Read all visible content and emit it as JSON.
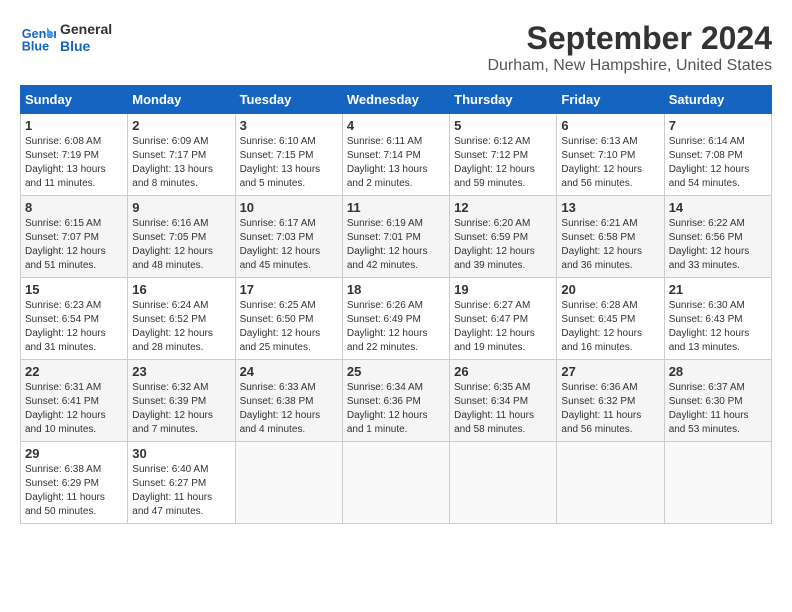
{
  "header": {
    "logo_line1": "General",
    "logo_line2": "Blue",
    "month": "September 2024",
    "location": "Durham, New Hampshire, United States"
  },
  "weekdays": [
    "Sunday",
    "Monday",
    "Tuesday",
    "Wednesday",
    "Thursday",
    "Friday",
    "Saturday"
  ],
  "weeks": [
    [
      {
        "day": "1",
        "info": "Sunrise: 6:08 AM\nSunset: 7:19 PM\nDaylight: 13 hours and 11 minutes."
      },
      {
        "day": "2",
        "info": "Sunrise: 6:09 AM\nSunset: 7:17 PM\nDaylight: 13 hours and 8 minutes."
      },
      {
        "day": "3",
        "info": "Sunrise: 6:10 AM\nSunset: 7:15 PM\nDaylight: 13 hours and 5 minutes."
      },
      {
        "day": "4",
        "info": "Sunrise: 6:11 AM\nSunset: 7:14 PM\nDaylight: 13 hours and 2 minutes."
      },
      {
        "day": "5",
        "info": "Sunrise: 6:12 AM\nSunset: 7:12 PM\nDaylight: 12 hours and 59 minutes."
      },
      {
        "day": "6",
        "info": "Sunrise: 6:13 AM\nSunset: 7:10 PM\nDaylight: 12 hours and 56 minutes."
      },
      {
        "day": "7",
        "info": "Sunrise: 6:14 AM\nSunset: 7:08 PM\nDaylight: 12 hours and 54 minutes."
      }
    ],
    [
      {
        "day": "8",
        "info": "Sunrise: 6:15 AM\nSunset: 7:07 PM\nDaylight: 12 hours and 51 minutes."
      },
      {
        "day": "9",
        "info": "Sunrise: 6:16 AM\nSunset: 7:05 PM\nDaylight: 12 hours and 48 minutes."
      },
      {
        "day": "10",
        "info": "Sunrise: 6:17 AM\nSunset: 7:03 PM\nDaylight: 12 hours and 45 minutes."
      },
      {
        "day": "11",
        "info": "Sunrise: 6:19 AM\nSunset: 7:01 PM\nDaylight: 12 hours and 42 minutes."
      },
      {
        "day": "12",
        "info": "Sunrise: 6:20 AM\nSunset: 6:59 PM\nDaylight: 12 hours and 39 minutes."
      },
      {
        "day": "13",
        "info": "Sunrise: 6:21 AM\nSunset: 6:58 PM\nDaylight: 12 hours and 36 minutes."
      },
      {
        "day": "14",
        "info": "Sunrise: 6:22 AM\nSunset: 6:56 PM\nDaylight: 12 hours and 33 minutes."
      }
    ],
    [
      {
        "day": "15",
        "info": "Sunrise: 6:23 AM\nSunset: 6:54 PM\nDaylight: 12 hours and 31 minutes."
      },
      {
        "day": "16",
        "info": "Sunrise: 6:24 AM\nSunset: 6:52 PM\nDaylight: 12 hours and 28 minutes."
      },
      {
        "day": "17",
        "info": "Sunrise: 6:25 AM\nSunset: 6:50 PM\nDaylight: 12 hours and 25 minutes."
      },
      {
        "day": "18",
        "info": "Sunrise: 6:26 AM\nSunset: 6:49 PM\nDaylight: 12 hours and 22 minutes."
      },
      {
        "day": "19",
        "info": "Sunrise: 6:27 AM\nSunset: 6:47 PM\nDaylight: 12 hours and 19 minutes."
      },
      {
        "day": "20",
        "info": "Sunrise: 6:28 AM\nSunset: 6:45 PM\nDaylight: 12 hours and 16 minutes."
      },
      {
        "day": "21",
        "info": "Sunrise: 6:30 AM\nSunset: 6:43 PM\nDaylight: 12 hours and 13 minutes."
      }
    ],
    [
      {
        "day": "22",
        "info": "Sunrise: 6:31 AM\nSunset: 6:41 PM\nDaylight: 12 hours and 10 minutes."
      },
      {
        "day": "23",
        "info": "Sunrise: 6:32 AM\nSunset: 6:39 PM\nDaylight: 12 hours and 7 minutes."
      },
      {
        "day": "24",
        "info": "Sunrise: 6:33 AM\nSunset: 6:38 PM\nDaylight: 12 hours and 4 minutes."
      },
      {
        "day": "25",
        "info": "Sunrise: 6:34 AM\nSunset: 6:36 PM\nDaylight: 12 hours and 1 minute."
      },
      {
        "day": "26",
        "info": "Sunrise: 6:35 AM\nSunset: 6:34 PM\nDaylight: 11 hours and 58 minutes."
      },
      {
        "day": "27",
        "info": "Sunrise: 6:36 AM\nSunset: 6:32 PM\nDaylight: 11 hours and 56 minutes."
      },
      {
        "day": "28",
        "info": "Sunrise: 6:37 AM\nSunset: 6:30 PM\nDaylight: 11 hours and 53 minutes."
      }
    ],
    [
      {
        "day": "29",
        "info": "Sunrise: 6:38 AM\nSunset: 6:29 PM\nDaylight: 11 hours and 50 minutes."
      },
      {
        "day": "30",
        "info": "Sunrise: 6:40 AM\nSunset: 6:27 PM\nDaylight: 11 hours and 47 minutes."
      },
      {
        "day": "",
        "info": ""
      },
      {
        "day": "",
        "info": ""
      },
      {
        "day": "",
        "info": ""
      },
      {
        "day": "",
        "info": ""
      },
      {
        "day": "",
        "info": ""
      }
    ]
  ]
}
